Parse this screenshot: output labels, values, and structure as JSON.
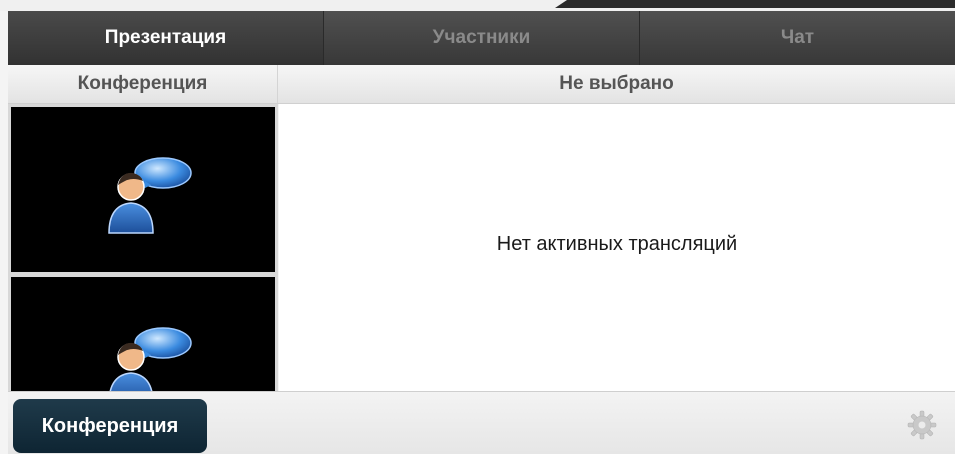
{
  "tabs": [
    {
      "label": "Презентация",
      "active": true
    },
    {
      "label": "Участники",
      "active": false
    },
    {
      "label": "Чат",
      "active": false
    }
  ],
  "subheader": {
    "left": "Конференция",
    "right": "Не выбрано"
  },
  "main": {
    "message": "Нет активных трансляций"
  },
  "bottombar": {
    "conference_button": "Конференция",
    "settings_icon": "gear-icon"
  },
  "thumbnails": [
    {
      "icon": "participant-speech-icon"
    },
    {
      "icon": "participant-speech-icon"
    }
  ],
  "colors": {
    "tab_bar": "#3d3d3d",
    "active_tab_text": "#ffffff",
    "inactive_tab_text": "#8a8a8a",
    "button": "#0e2533"
  }
}
